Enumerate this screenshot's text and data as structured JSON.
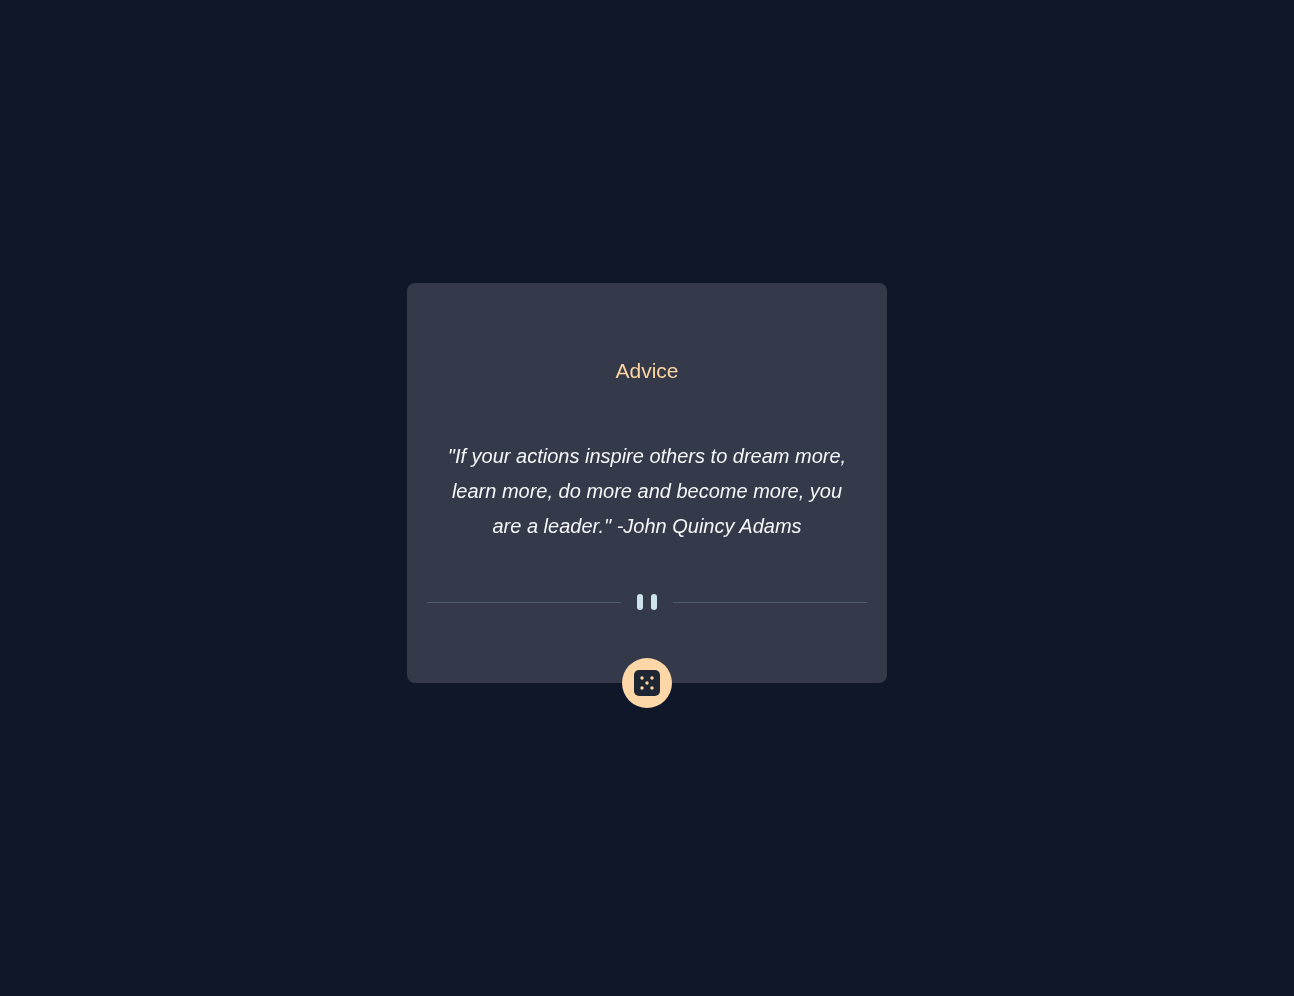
{
  "card": {
    "title": "Advice",
    "quote": "\"If your actions inspire others to dream more, learn more, do more and become more, you are a leader.\" -John Quincy Adams"
  }
}
